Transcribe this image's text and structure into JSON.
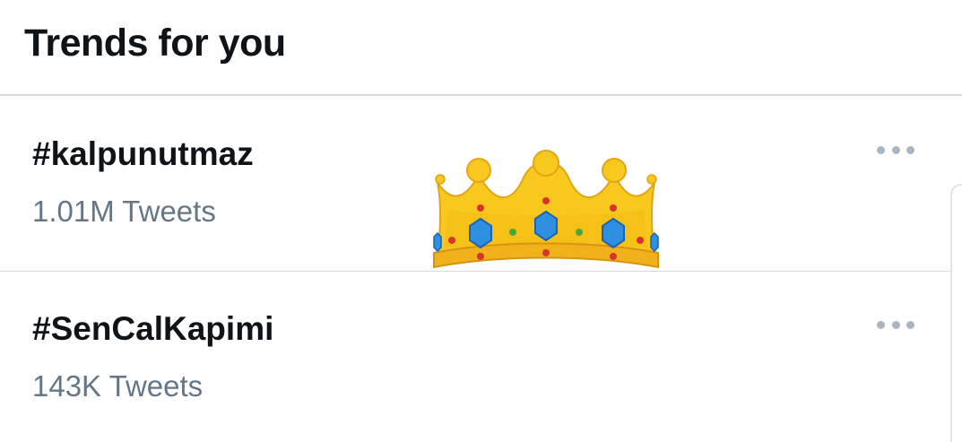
{
  "header": {
    "title": "Trends for you"
  },
  "trends": [
    {
      "name": "#kalpunutmaz",
      "tweet_count": "1.01M Tweets",
      "more_icon": "more-horizontal-icon"
    },
    {
      "name": "#SenCalKapimi",
      "tweet_count": "143K Tweets",
      "more_icon": "more-horizontal-icon"
    }
  ],
  "overlay": {
    "emoji": "crown-emoji"
  },
  "colors": {
    "text_primary": "#0f1419",
    "text_secondary": "#657786",
    "divider": "#d3dbe0",
    "more_dots": "#a8b6c1",
    "crown_gold": "#f5c518",
    "crown_gem_blue": "#2f8fe0",
    "crown_gem_red": "#d9342b"
  }
}
